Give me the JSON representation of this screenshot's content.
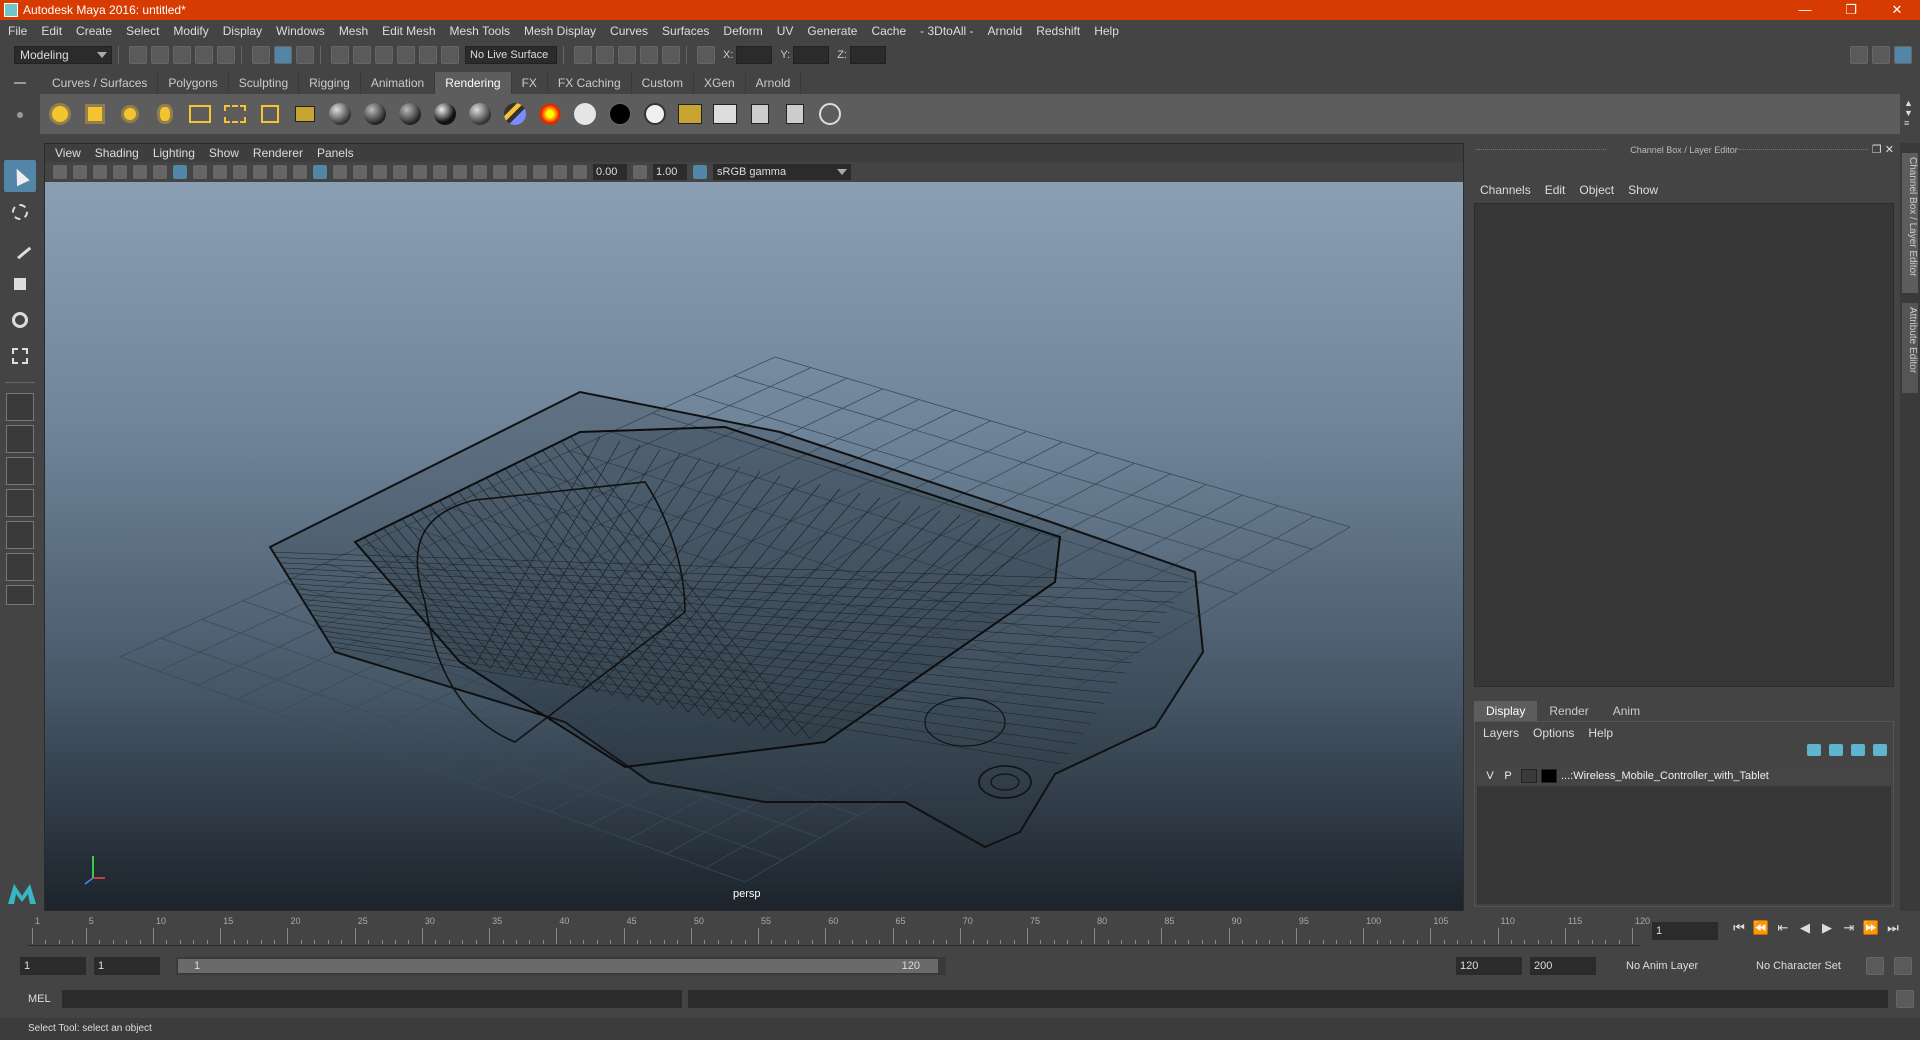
{
  "window": {
    "title": "Autodesk Maya 2016: untitled*",
    "min": "—",
    "max": "❐",
    "close": "✕"
  },
  "menubar": [
    "File",
    "Edit",
    "Create",
    "Select",
    "Modify",
    "Display",
    "Windows",
    "Mesh",
    "Edit Mesh",
    "Mesh Tools",
    "Mesh Display",
    "Curves",
    "Surfaces",
    "Deform",
    "UV",
    "Generate",
    "Cache",
    "- 3DtoAll -",
    "Arnold",
    "Redshift",
    "Help"
  ],
  "statusline": {
    "mode": "Modeling",
    "live_surface": "No Live Surface",
    "x_label": "X:",
    "y_label": "Y:",
    "z_label": "Z:"
  },
  "shelf": {
    "tabs": [
      "Curves / Surfaces",
      "Polygons",
      "Sculpting",
      "Rigging",
      "Animation",
      "Rendering",
      "FX",
      "FX Caching",
      "Custom",
      "XGen",
      "Arnold"
    ],
    "active_tab": "Rendering"
  },
  "viewport": {
    "menu": [
      "View",
      "Shading",
      "Lighting",
      "Show",
      "Renderer",
      "Panels"
    ],
    "field_a": "0.00",
    "field_b": "1.00",
    "color_space": "sRGB gamma",
    "camera_label": "persp"
  },
  "channel_box": {
    "title": "Channel Box / Layer Editor",
    "menu": [
      "Channels",
      "Edit",
      "Object",
      "Show"
    ]
  },
  "layer_editor": {
    "tabs": [
      "Display",
      "Render",
      "Anim"
    ],
    "active_tab": "Display",
    "menu": [
      "Layers",
      "Options",
      "Help"
    ],
    "layers": [
      {
        "v": "V",
        "p": "P",
        "name": "...:Wireless_Mobile_Controller_with_Tablet"
      }
    ]
  },
  "side_tabs": [
    "Channel Box / Layer Editor",
    "Attribute Editor"
  ],
  "timeslider": {
    "ticks": [
      "1",
      "5",
      "10",
      "15",
      "20",
      "25",
      "30",
      "35",
      "40",
      "45",
      "50",
      "55",
      "60",
      "65",
      "70",
      "75",
      "80",
      "85",
      "90",
      "95",
      "100",
      "105",
      "110",
      "115",
      "120"
    ],
    "current_frame": "1"
  },
  "range": {
    "start": "1",
    "playback_start": "1",
    "range_start": "1",
    "range_end": "120",
    "playback_end": "120",
    "end": "200",
    "anim_layer": "No Anim Layer",
    "character_set": "No Character Set"
  },
  "cmdline": {
    "label": "MEL"
  },
  "helpline": {
    "text": "Select Tool: select an object"
  },
  "colors": {
    "titlebar": "#d83b01",
    "accent": "#5285a6",
    "shelf_bg": "#5d5d5d"
  }
}
